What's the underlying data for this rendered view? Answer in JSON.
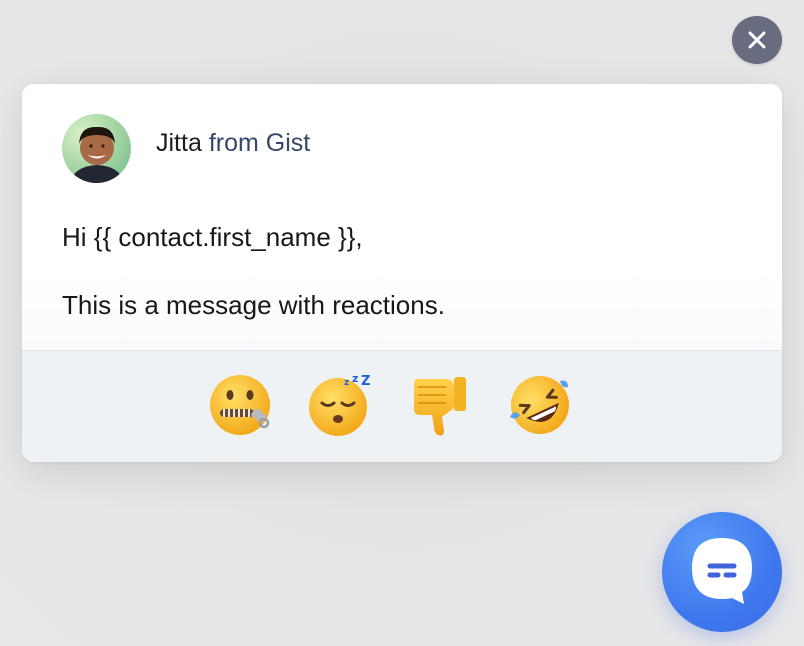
{
  "close_button": {
    "icon": "close-icon"
  },
  "message_card": {
    "sender": {
      "name": "Jitta",
      "company": "from Gist",
      "avatar_icon": "avatar-photo"
    },
    "body": {
      "greeting": "Hi {{ contact.first_name }},",
      "text": "This is a message with reactions."
    },
    "reactions": [
      {
        "icon": "zipper-mouth-face-icon"
      },
      {
        "icon": "sleeping-face-icon"
      },
      {
        "icon": "thumbs-down-icon"
      },
      {
        "icon": "rolling-on-floor-laughing-icon"
      }
    ]
  },
  "launcher": {
    "icon": "chat-bubble-icon"
  },
  "colors": {
    "launcher_blue": "#3f78ee",
    "close_button_gray": "#676c80",
    "company_text": "#34486b",
    "reaction_bar": "#eef2f5"
  }
}
